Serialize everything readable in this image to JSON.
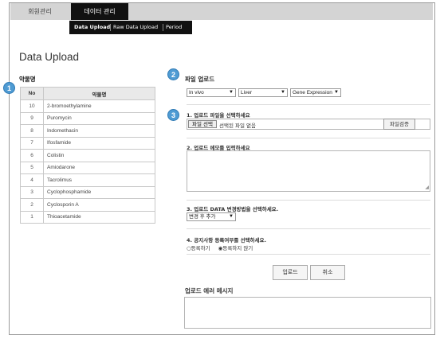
{
  "top_tabs": [
    {
      "label": "회원관리"
    },
    {
      "label": "데이터 관리"
    }
  ],
  "sub_tabs": [
    {
      "label": "Data Upload"
    },
    {
      "label": "Raw Data Upload"
    },
    {
      "label": "Period"
    }
  ],
  "page_title": "Data Upload",
  "drug_panel": {
    "label": "약물명",
    "col_no": "No",
    "col_name": "약물명",
    "rows": [
      {
        "no": "10",
        "name": "2-bromoethylamine"
      },
      {
        "no": "9",
        "name": "Puromycin"
      },
      {
        "no": "8",
        "name": "Indomethacin"
      },
      {
        "no": "7",
        "name": "Ifosfamide"
      },
      {
        "no": "6",
        "name": "Colistin"
      },
      {
        "no": "5",
        "name": "Amiodarone"
      },
      {
        "no": "4",
        "name": "Tacrolimus"
      },
      {
        "no": "3",
        "name": "Cyclophosphamide"
      },
      {
        "no": "2",
        "name": "Cyclosporin A"
      },
      {
        "no": "1",
        "name": "Thioacetamide"
      }
    ]
  },
  "badges": [
    "1",
    "2",
    "3"
  ],
  "upload": {
    "label": "파일 업로드",
    "select_model": "In vivo",
    "select_organ": "Liver",
    "select_type": "Gene Expression",
    "q1": "1. 업로드 파일을 선택하세요",
    "file_button": "파일 선택",
    "file_none": "선택된 파일 없음",
    "verify_button": "파일검증",
    "q2": "2. 업로드 메모를 입력하세요",
    "q3": "3. 업로드 DATA 변경방법을 선택하세요.",
    "change_method": "변경 후 추가",
    "q4": "4. 공지사항 등록여부를 선택하세요.",
    "radio_register": "등록하기",
    "radio_no_register": "등록하지 않기",
    "upload_button": "업로드",
    "cancel_button": "취소",
    "error_label": "업로드 에러 메시지"
  }
}
